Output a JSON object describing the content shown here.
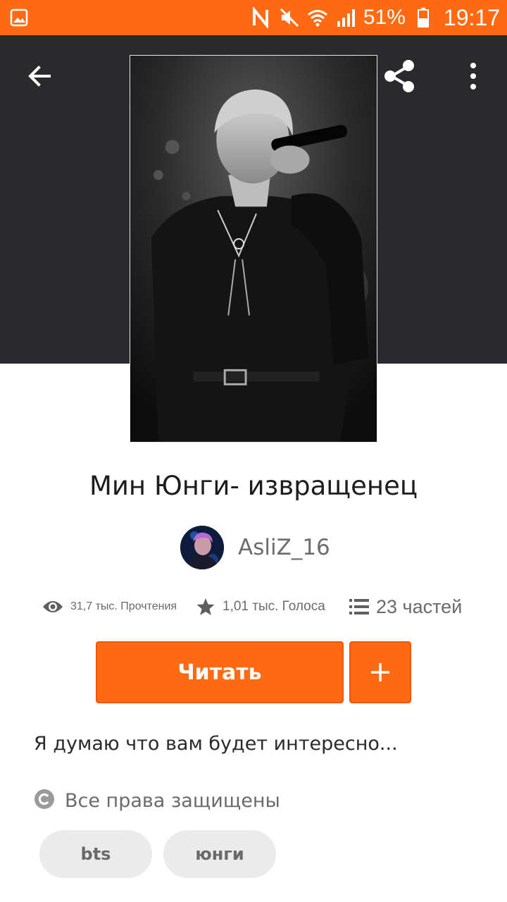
{
  "status_bar": {
    "battery_percent": "51%",
    "time": "19:17",
    "icons": [
      "gallery-icon",
      "nfc-icon",
      "mute-icon",
      "wifi-icon",
      "signal-icon",
      "battery-icon"
    ]
  },
  "header": {
    "back_icon": "arrow-left-icon",
    "share_icon": "share-icon",
    "more_icon": "more-vert-icon"
  },
  "story": {
    "title": "Мин Юнги- извращенец",
    "author": "AsliZ_16",
    "stats": {
      "reads": "31,7 тыс. Прочтения",
      "votes": "1,01 тыс. Голоса",
      "parts": "23 частей"
    },
    "read_button": "Читать",
    "description": "Я думаю что вам будет интересно...",
    "rights": "Все права защищены",
    "tags": [
      "bts",
      "юнги"
    ]
  },
  "colors": {
    "accent": "#ff6a13",
    "header_bg": "#2a2a2c",
    "tag_bg": "#ebebeb"
  }
}
